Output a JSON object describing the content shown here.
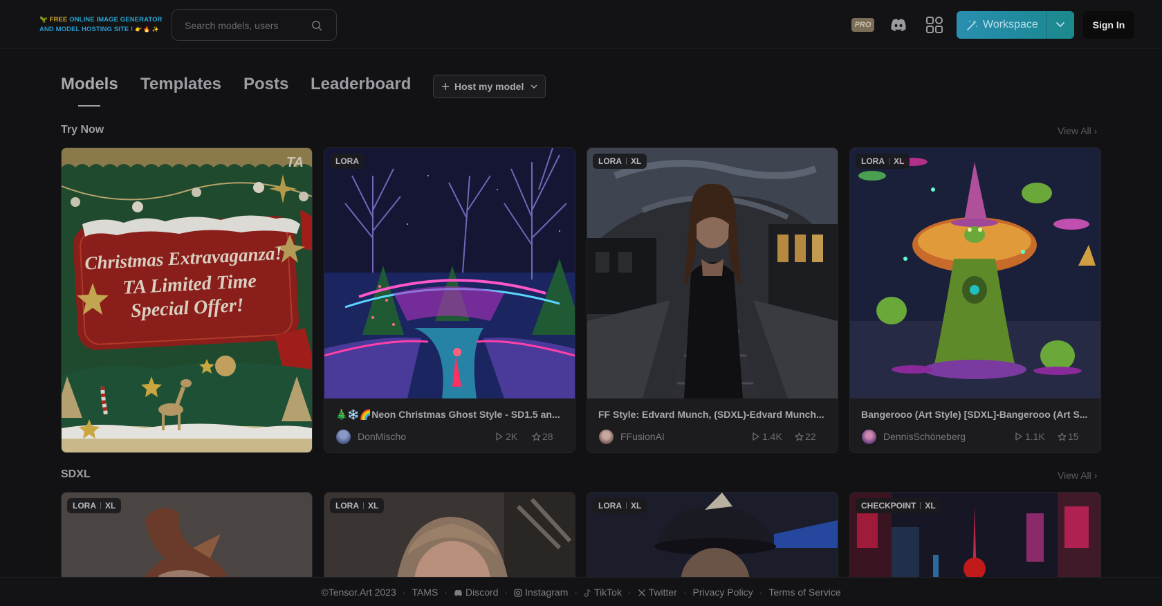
{
  "header": {
    "logo_line1_prefix": "🦖",
    "logo_line1_hl": "FREE",
    "logo_line1_rest": "ONLINE IMAGE GENERATOR",
    "logo_line2": "AND MODEL HOSTING SITE !",
    "logo_line2_dim": "👉 🔥 ✨",
    "search_placeholder": "Search models, users",
    "pro_label": "PRO",
    "workspace_label": "Workspace",
    "signin_label": "Sign In"
  },
  "nav": {
    "tabs": [
      "Models",
      "Templates",
      "Posts",
      "Leaderboard"
    ],
    "active": "Models",
    "host_label": "Host my model"
  },
  "sections": [
    {
      "title": "Try Now",
      "view_all": "View All"
    },
    {
      "title": "SDXL",
      "view_all": "View All"
    }
  ],
  "try_now": {
    "promo": {
      "text_line1": "Christmas Extravaganza!",
      "text_line2": "TA Limited Time",
      "text_line3": "Special Offer!",
      "corner_logo": "TA"
    },
    "cards": [
      {
        "badges": [
          "LORA"
        ],
        "title": "🎄❄️🌈Neon Christmas Ghost Style - SD1.5 an...",
        "user": "DonMischo",
        "runs": "2K",
        "stars": "28"
      },
      {
        "badges": [
          "LORA",
          "XL"
        ],
        "title": "FF Style: Edvard Munch, (SDXL)-Edvard Munch...",
        "user": "FFusionAI",
        "runs": "1.4K",
        "stars": "22"
      },
      {
        "badges": [
          "LORA",
          "XL"
        ],
        "title": "Bangerooo (Art Style) [SDXL]-Bangerooo (Art S...",
        "user": "DennisSchöneberg",
        "runs": "1.1K",
        "stars": "15"
      }
    ]
  },
  "sdxl": {
    "cards": [
      {
        "badges": [
          "LORA",
          "XL"
        ]
      },
      {
        "badges": [
          "LORA",
          "XL"
        ]
      },
      {
        "badges": [
          "LORA",
          "XL"
        ]
      },
      {
        "badges": [
          "CHECKPOINT",
          "XL"
        ]
      }
    ]
  },
  "footer": {
    "copyright": "©Tensor.Art 2023",
    "links": [
      "TAMS",
      "Discord",
      "Instagram",
      "TikTok",
      "Twitter",
      "Privacy Policy",
      "Terms of Service"
    ]
  },
  "colors": {
    "background": "#121214",
    "workspace_gradient_start": "#2a8fb0",
    "workspace_gradient_end": "#1b8a8a",
    "logo_blue": "#2aa6d0",
    "logo_gold": "#d4a72c"
  }
}
